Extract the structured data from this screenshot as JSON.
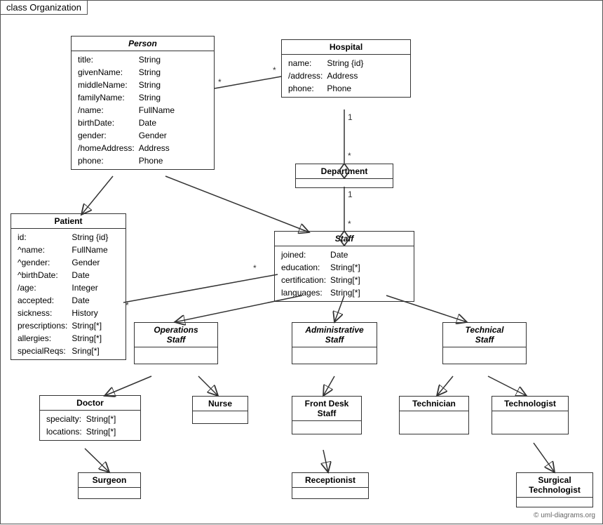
{
  "diagram": {
    "title": "class Organization",
    "copyright": "© uml-diagrams.org",
    "classes": {
      "person": {
        "name": "Person",
        "italic": true,
        "attributes": [
          [
            "title:",
            "String"
          ],
          [
            "givenName:",
            "String"
          ],
          [
            "middleName:",
            "String"
          ],
          [
            "familyName:",
            "String"
          ],
          [
            "/name:",
            "FullName"
          ],
          [
            "birthDate:",
            "Date"
          ],
          [
            "gender:",
            "Gender"
          ],
          [
            "/homeAddress:",
            "Address"
          ],
          [
            "phone:",
            "Phone"
          ]
        ]
      },
      "hospital": {
        "name": "Hospital",
        "italic": false,
        "attributes": [
          [
            "name:",
            "String {id}"
          ],
          [
            "/address:",
            "Address"
          ],
          [
            "phone:",
            "Phone"
          ]
        ]
      },
      "department": {
        "name": "Department",
        "italic": false,
        "attributes": []
      },
      "staff": {
        "name": "Staff",
        "italic": true,
        "attributes": [
          [
            "joined:",
            "Date"
          ],
          [
            "education:",
            "String[*]"
          ],
          [
            "certification:",
            "String[*]"
          ],
          [
            "languages:",
            "String[*]"
          ]
        ]
      },
      "patient": {
        "name": "Patient",
        "italic": false,
        "attributes": [
          [
            "id:",
            "String {id}"
          ],
          [
            "^name:",
            "FullName"
          ],
          [
            "^gender:",
            "Gender"
          ],
          [
            "^birthDate:",
            "Date"
          ],
          [
            "/age:",
            "Integer"
          ],
          [
            "accepted:",
            "Date"
          ],
          [
            "sickness:",
            "History"
          ],
          [
            "prescriptions:",
            "String[*]"
          ],
          [
            "allergies:",
            "String[*]"
          ],
          [
            "specialReqs:",
            "Sring[*]"
          ]
        ]
      },
      "operations_staff": {
        "name": "Operations Staff",
        "italic": true,
        "attributes": []
      },
      "administrative_staff": {
        "name": "Administrative Staff",
        "italic": true,
        "attributes": []
      },
      "technical_staff": {
        "name": "Technical Staff",
        "italic": true,
        "attributes": []
      },
      "doctor": {
        "name": "Doctor",
        "italic": false,
        "attributes": [
          [
            "specialty:",
            "String[*]"
          ],
          [
            "locations:",
            "String[*]"
          ]
        ]
      },
      "nurse": {
        "name": "Nurse",
        "italic": false,
        "attributes": []
      },
      "front_desk_staff": {
        "name": "Front Desk Staff",
        "italic": false,
        "attributes": []
      },
      "technician": {
        "name": "Technician",
        "italic": false,
        "attributes": []
      },
      "technologist": {
        "name": "Technologist",
        "italic": false,
        "attributes": []
      },
      "surgeon": {
        "name": "Surgeon",
        "italic": false,
        "attributes": []
      },
      "receptionist": {
        "name": "Receptionist",
        "italic": false,
        "attributes": []
      },
      "surgical_technologist": {
        "name": "Surgical Technologist",
        "italic": false,
        "attributes": []
      }
    }
  }
}
